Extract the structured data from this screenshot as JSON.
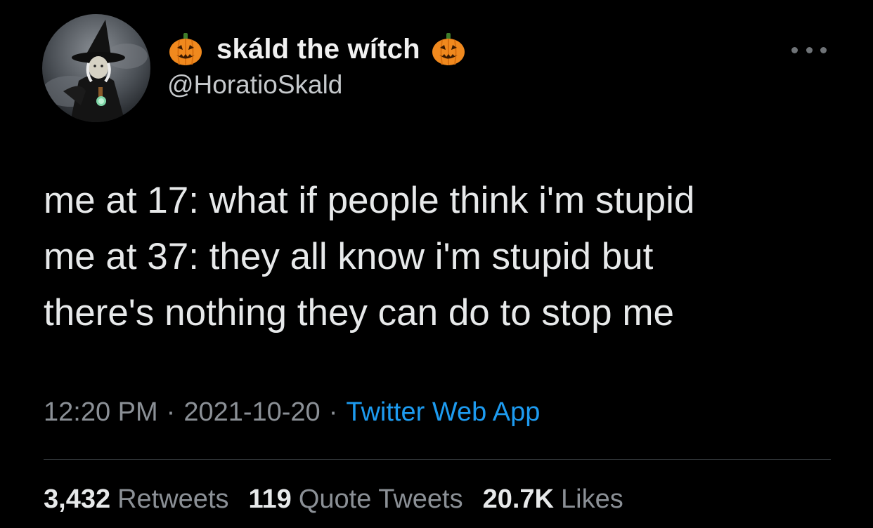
{
  "user": {
    "display_name": "skáld the wítch",
    "handle": "@HoratioSkald",
    "avatar_icon": "witch-avatar",
    "name_emoji": "jack-o-lantern"
  },
  "more_icon": "more-horizontal-icon",
  "tweet": {
    "lines": [
      "me at 17: what if people think i'm stupid",
      "me at 37: they all know i'm stupid but",
      "there's nothing they can do to stop me"
    ],
    "time": "12:20 PM",
    "separator": "·",
    "date": "2021-10-20",
    "source": "Twitter Web App"
  },
  "stats": {
    "retweets_count": "3,432",
    "retweets_label": "Retweets",
    "quotes_count": "119",
    "quotes_label": "Quote Tweets",
    "likes_count": "20.7K",
    "likes_label": "Likes"
  },
  "colors": {
    "background": "#000000",
    "text": "#e7e9ea",
    "secondary": "#8b9096",
    "link": "#1d9bf0",
    "pumpkin": "#f0891e"
  }
}
